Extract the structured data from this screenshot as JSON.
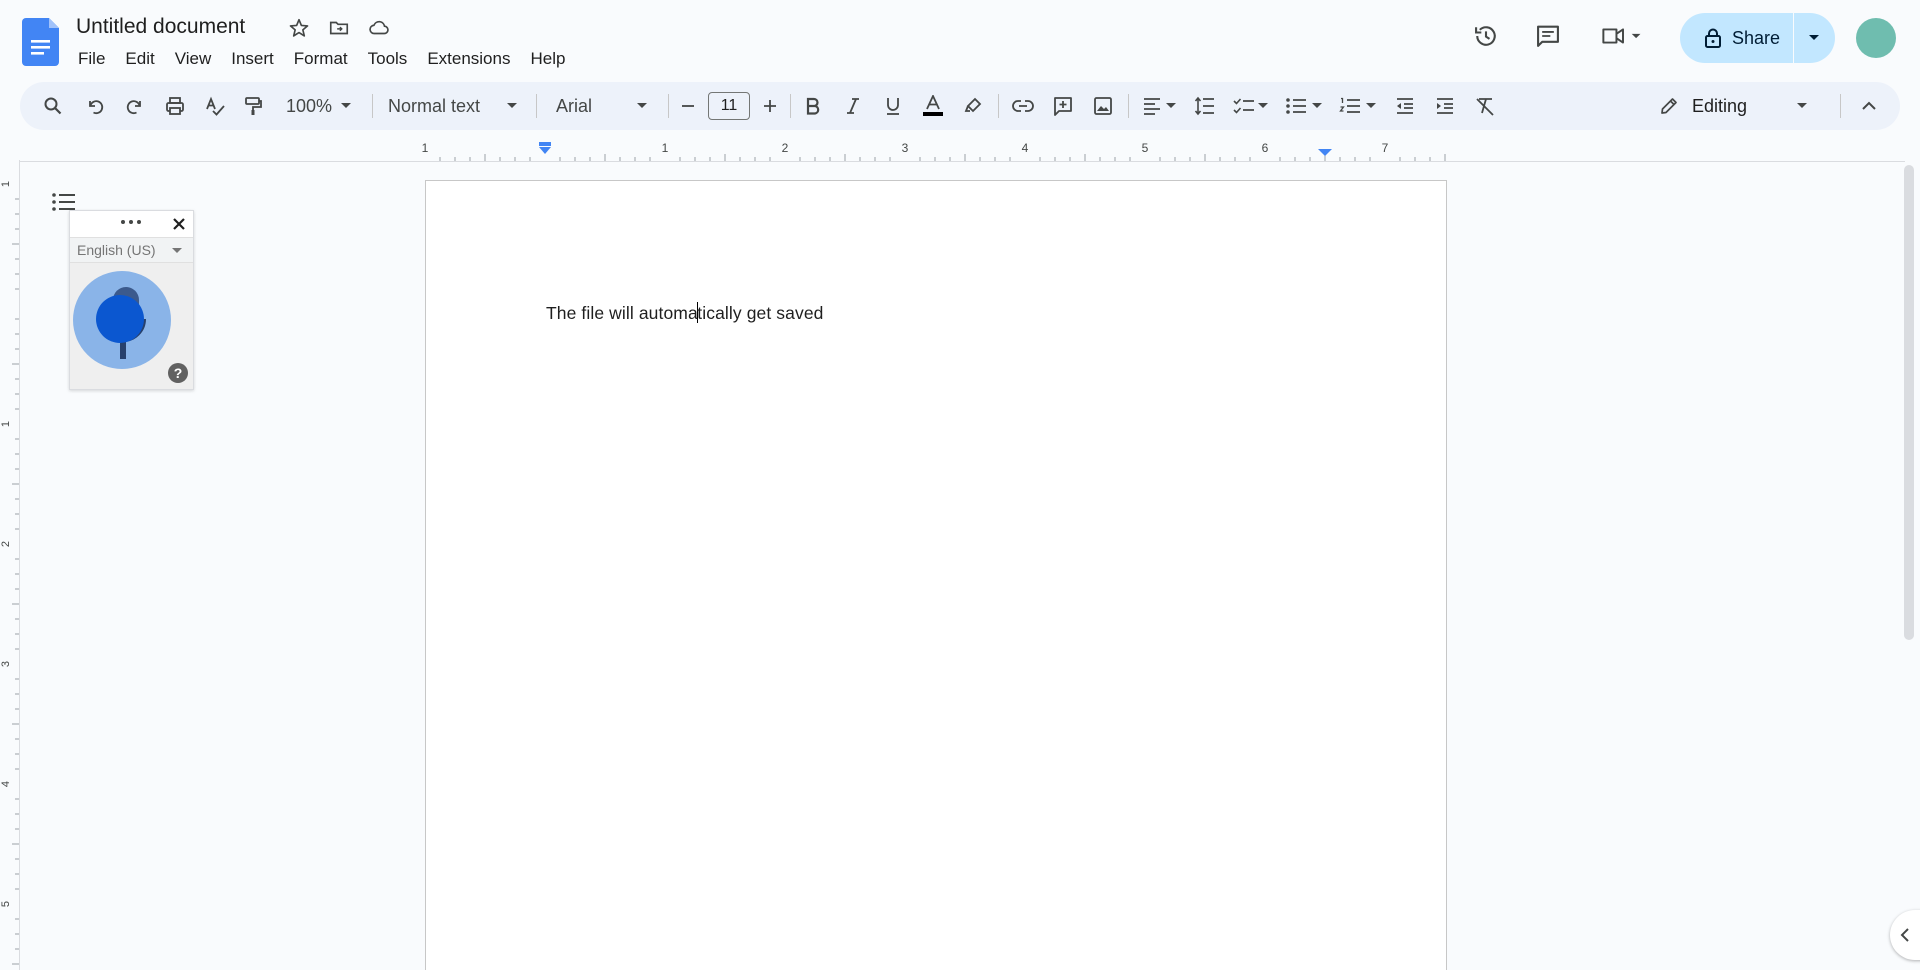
{
  "app": {
    "title": "Untitled document"
  },
  "menu": [
    "File",
    "Edit",
    "View",
    "Insert",
    "Format",
    "Tools",
    "Extensions",
    "Help"
  ],
  "header": {
    "share_label": "Share",
    "avatar_color": "#6fbdaf",
    "share_color": "#c2e7ff"
  },
  "toolbar": {
    "zoom": "100%",
    "style": "Normal text",
    "font": "Arial",
    "font_size": "11",
    "mode": "Editing"
  },
  "ruler": {
    "labels": [
      "1",
      "1",
      "2",
      "3",
      "4",
      "5",
      "6",
      "7"
    ]
  },
  "left_ruler": {
    "labels": [
      "1",
      "1",
      "2",
      "3",
      "4",
      "5"
    ]
  },
  "document": {
    "text_before_cursor": "The file will automa",
    "text_after_cursor": "tically get saved"
  },
  "voice_typing": {
    "language": "English (US)",
    "help": "?"
  },
  "colors": {
    "docs_blue": "#4285f4",
    "toolbar_bg": "#edf2fa",
    "mic_outer": "#8ab4e8",
    "mic_inner": "#0b57d0"
  }
}
